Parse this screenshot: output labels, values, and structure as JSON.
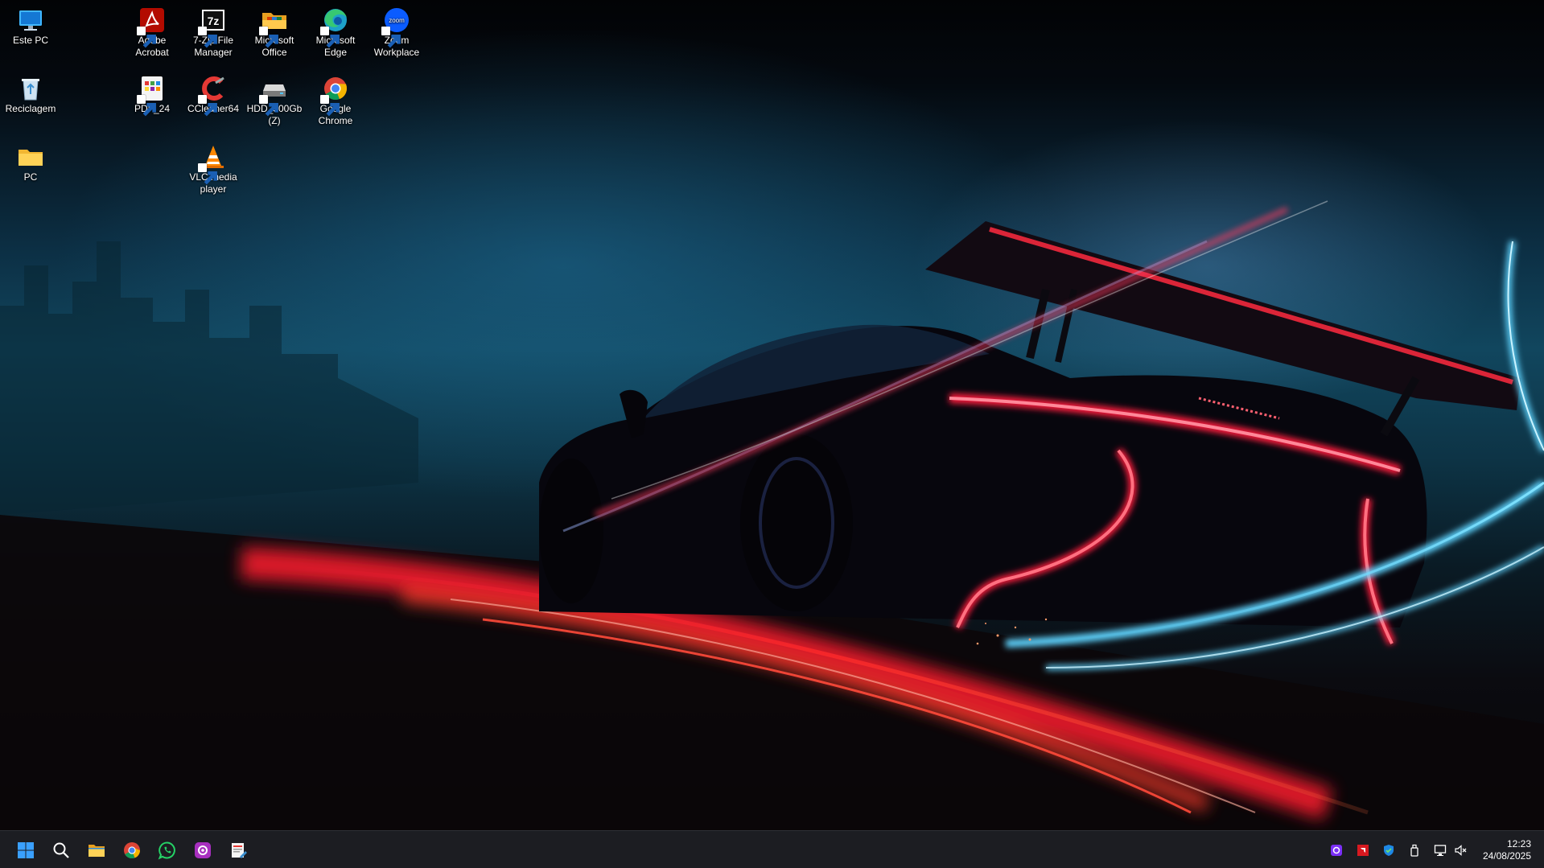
{
  "desktop": {
    "icons": [
      {
        "id": "este-pc",
        "label": "Este PC",
        "icon": "monitor-icon"
      },
      {
        "id": "reciclagem",
        "label": "Reciclagem",
        "icon": "recycle-bin-icon"
      },
      {
        "id": "pc",
        "label": "PC",
        "icon": "folder-icon"
      },
      {
        "id": "adobe-acrobat",
        "label": "Adobe Acrobat",
        "icon": "adobe-acrobat-icon"
      },
      {
        "id": "pdf24",
        "label": "PDF_24",
        "icon": "pdf24-icon"
      },
      {
        "id": "7zip",
        "label": "7-Zip File Manager",
        "icon": "7zip-icon"
      },
      {
        "id": "ccleaner",
        "label": "CCleaner64",
        "icon": "ccleaner-icon"
      },
      {
        "id": "vlc",
        "label": "VLC media player",
        "icon": "vlc-cone-icon"
      },
      {
        "id": "ms-office",
        "label": "Microsoft Office",
        "icon": "office-folder-icon"
      },
      {
        "id": "hdd",
        "label": "HDD_500Gb (Z)",
        "icon": "drive-icon"
      },
      {
        "id": "edge",
        "label": "Microsoft Edge",
        "icon": "edge-icon"
      },
      {
        "id": "chrome",
        "label": "Google Chrome",
        "icon": "chrome-icon"
      },
      {
        "id": "zoom",
        "label": "Zoom Workplace",
        "icon": "zoom-icon",
        "badge_text": "zoom"
      }
    ]
  },
  "taskbar": {
    "pinned": [
      {
        "id": "start",
        "icon": "windows-start-icon"
      },
      {
        "id": "search",
        "icon": "search-icon"
      },
      {
        "id": "file-explorer",
        "icon": "file-explorer-icon"
      },
      {
        "id": "chrome",
        "icon": "chrome-icon"
      },
      {
        "id": "whatsapp",
        "icon": "whatsapp-icon"
      },
      {
        "id": "screen-app",
        "icon": "camera-app-icon"
      },
      {
        "id": "editor-app",
        "icon": "document-edit-icon"
      }
    ],
    "tray": [
      {
        "id": "tray-app",
        "icon": "camera-app-icon"
      },
      {
        "id": "tray-amd",
        "icon": "amd-icon"
      },
      {
        "id": "tray-defender",
        "icon": "shield-icon"
      },
      {
        "id": "tray-usb",
        "icon": "usb-drive-icon"
      },
      {
        "id": "tray-network",
        "icon": "network-icon"
      },
      {
        "id": "tray-volume",
        "icon": "volume-muted-icon"
      }
    ],
    "clock": {
      "time": "12:23",
      "date": "24/08/2025"
    }
  },
  "colors": {
    "taskbar_bg": "#1c1d22",
    "windows_blue": "#1e90ff",
    "neon_red": "#ff1f3d",
    "neon_cyan": "#5fd4ff"
  }
}
